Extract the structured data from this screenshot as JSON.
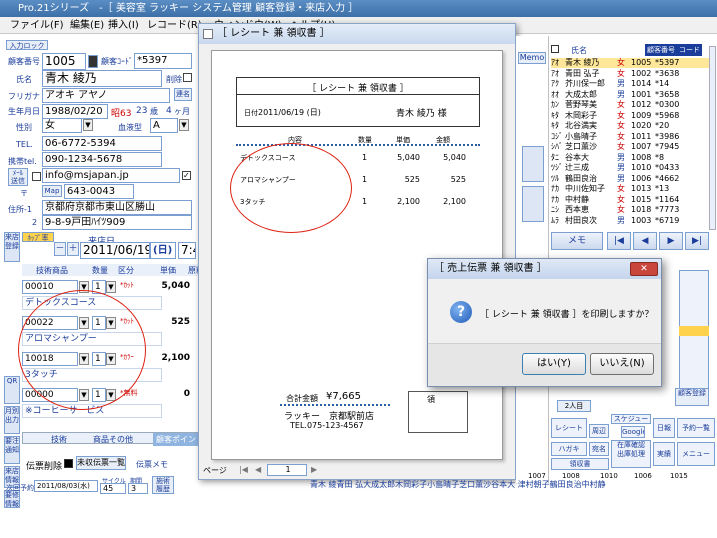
{
  "window": {
    "title": "Pro.21シリーズ　-［ 美容室 ラッキー  システム管理  顧客登録・来店入力 ］"
  },
  "menu": {
    "items": [
      "ファイル(F)",
      "編集(E)",
      "挿入(I)",
      "レコード(R)",
      "ウィンドウ(W)",
      "ヘルプ(H)"
    ]
  },
  "customer": {
    "input_lock": "入力ロック",
    "no_label": "顧客番号",
    "no": "1005",
    "code_label": "顧客ｺｰﾄﾞ",
    "code": "*5397",
    "name_label": "氏名",
    "name": "青木 綾乃",
    "delete_label": "削除",
    "kana_label": "フリガナ",
    "kana": "アオキ アヤノ",
    "link_label": "連名",
    "birth_label": "生年月日",
    "birth": "1988/02/20",
    "era": "昭63",
    "age": "23",
    "age_unit": "歳",
    "month": "4",
    "month_unit": "ヶ月",
    "gender_label": "性別",
    "gender": "女",
    "blood_label": "血液型",
    "blood": "A",
    "tel_label": "TEL.",
    "tel": "06-6772-5394",
    "mobile_label": "携帯tel.",
    "mobile": "090-1234-5678",
    "mail_label": "ﾒｰﾙ",
    "mail_sub": "送信",
    "email": "info@msjapan.jp",
    "zip_label": "〒",
    "map_label": "Map",
    "zip": "643-0043",
    "address_label": "住所-1",
    "address_2_label": "2",
    "address1": "京都府京都市東山区勝山",
    "address2": "9-8-9戸田ﾊｲﾂ909"
  },
  "visit": {
    "side_register": "来店登録",
    "dropdown_label": "ﾎｯﾌﾟ率",
    "date_label": "来店日",
    "date": "2011/06/19",
    "weekday": "(日)",
    "time": "7:4",
    "headers": [
      "技術商品",
      "数量",
      "区分",
      "単価",
      "原料"
    ],
    "rows": [
      {
        "code": "00010",
        "qty": "1",
        "tag": "*ｶｯﾄ",
        "price": "5,040",
        "name": "デトックスコース"
      },
      {
        "code": "00022",
        "qty": "1",
        "tag": "*ｶｯﾄ",
        "price": "525",
        "name": "アロマシャンプー"
      },
      {
        "code": "10018",
        "qty": "1",
        "tag": "*ｶﾗｰ",
        "price": "2,100",
        "name": "3タッチ"
      },
      {
        "code": "00000",
        "qty": "1",
        "tag": "*無料",
        "price": "0",
        "name": "※コーヒーサービス"
      }
    ],
    "side_buttons": [
      "QR",
      "月別\n出力",
      "要注\n通知",
      "来店\n情報",
      "要修\n情報"
    ],
    "bottom_tabs": [
      "技術",
      "商品その他",
      "顧客ポイント"
    ],
    "slip_delete": "伝票削除",
    "unreceived": "未収伝票一覧",
    "slip_memo": "伝票メモ",
    "next_label": "次回予約",
    "next_date": "2011/08/03(水)",
    "cycle_label": "サイクル",
    "cycle": "45",
    "interval_label": "期間",
    "interval": "3",
    "history_label": "施術\n履歴"
  },
  "receipt_window": {
    "title": "［ レシート 兼 領収書 ］",
    "paper": {
      "heading": "［ レシート 兼 領収書 ］",
      "date_label": "日付",
      "date": "2011/06/19 (日)",
      "customer": "青木 綾乃 様",
      "cols": [
        "内容",
        "数量",
        "単価",
        "金額"
      ],
      "rows": [
        {
          "item": "デトックスコース",
          "qty": "1",
          "price": "5,040",
          "amount": "5,040"
        },
        {
          "item": "アロマシャンプー",
          "qty": "1",
          "price": "525",
          "amount": "525"
        },
        {
          "item": "3タッチ",
          "qty": "1",
          "price": "2,100",
          "amount": "2,100"
        }
      ],
      "total_label": "合計金額",
      "total": "¥7,665",
      "shop": "ラッキー　京都駅前店",
      "shop_tel": "TEL.075-123-4567",
      "stamp": "領"
    },
    "page_label": "ページ",
    "page_no": "1"
  },
  "dialog": {
    "title": "［ 売上伝票 兼 領収書 ］",
    "message": "［ レシート 兼 領収書 ］を印刷しますか？",
    "yes": "はい(Y)",
    "no": "いいえ(N)"
  },
  "midcol": {
    "memo": "Memo"
  },
  "customer_list": {
    "headers": [
      "氏名",
      "顧客番号",
      "コード"
    ],
    "rows": [
      {
        "kana": "ｱｵ",
        "name": "青木 綾乃",
        "gender": "女",
        "no": "1005",
        "code": "*5397"
      },
      {
        "kana": "ｱｵ",
        "name": "青田 弘子",
        "gender": "女",
        "no": "1002",
        "code": "*3638"
      },
      {
        "kana": "ｱｸ",
        "name": "芥川保一郎",
        "gender": "男",
        "no": "1014",
        "code": "*14"
      },
      {
        "kana": "ｵｵ",
        "name": "大成太郎",
        "gender": "男",
        "no": "1001",
        "code": "*3658"
      },
      {
        "kana": "ｶﾝ",
        "name": "菅野琴美",
        "gender": "女",
        "no": "1012",
        "code": "*0300"
      },
      {
        "kana": "ｷﾀ",
        "name": "木岡彩子",
        "gender": "女",
        "no": "1009",
        "code": "*5968"
      },
      {
        "kana": "ｷﾀ",
        "name": "北谷満実",
        "gender": "女",
        "no": "1020",
        "code": "*20"
      },
      {
        "kana": "ｺｼﾞ",
        "name": "小島晴子",
        "gender": "女",
        "no": "1011",
        "code": "*3986"
      },
      {
        "kana": "ｼﾊﾞ",
        "name": "芝口薫沙",
        "gender": "女",
        "no": "1007",
        "code": "*7945"
      },
      {
        "kana": "ﾀﾆ",
        "name": "谷本大",
        "gender": "男",
        "no": "1008",
        "code": "*8"
      },
      {
        "kana": "ﾂｼﾞ",
        "name": "辻三成",
        "gender": "男",
        "no": "1010",
        "code": "*0433"
      },
      {
        "kana": "ﾂﾙ",
        "name": "鶴田良治",
        "gender": "男",
        "no": "1006",
        "code": "*4662"
      },
      {
        "kana": "ﾅｶ",
        "name": "中川佐知子",
        "gender": "女",
        "no": "1013",
        "code": "*13"
      },
      {
        "kana": "ﾅｶ",
        "name": "中村静",
        "gender": "女",
        "no": "1015",
        "code": "*1164"
      },
      {
        "kana": "ﾆｼ",
        "name": "西本恵",
        "gender": "女",
        "no": "1018",
        "code": "*7773"
      },
      {
        "kana": "ﾑﾗ",
        "name": "村田良次",
        "gender": "男",
        "no": "1003",
        "code": "*6719"
      }
    ],
    "memo": "メモ",
    "nav": [
      "|◀",
      "◀",
      "▶",
      "▶|"
    ],
    "sub_labels": [
      "顧客登録"
    ],
    "people": "2人目",
    "tools": [
      "レシート",
      "周辺",
      "スケジュール",
      "Google",
      "日報",
      "予約一覧",
      "ハガキ",
      "宛名",
      "在庫確認\n出庫処理",
      "実績",
      "メニュー"
    ],
    "receipt_book": "領収書"
  },
  "bottom_strip": {
    "names": "青木 綾青田 弘大成太郎木岡彩子小島晴子芝口薫沙谷本大 津村朝子鶴田良治中村静",
    "nums": [
      "1007",
      "1008",
      "1010",
      "1006",
      "1015"
    ]
  }
}
